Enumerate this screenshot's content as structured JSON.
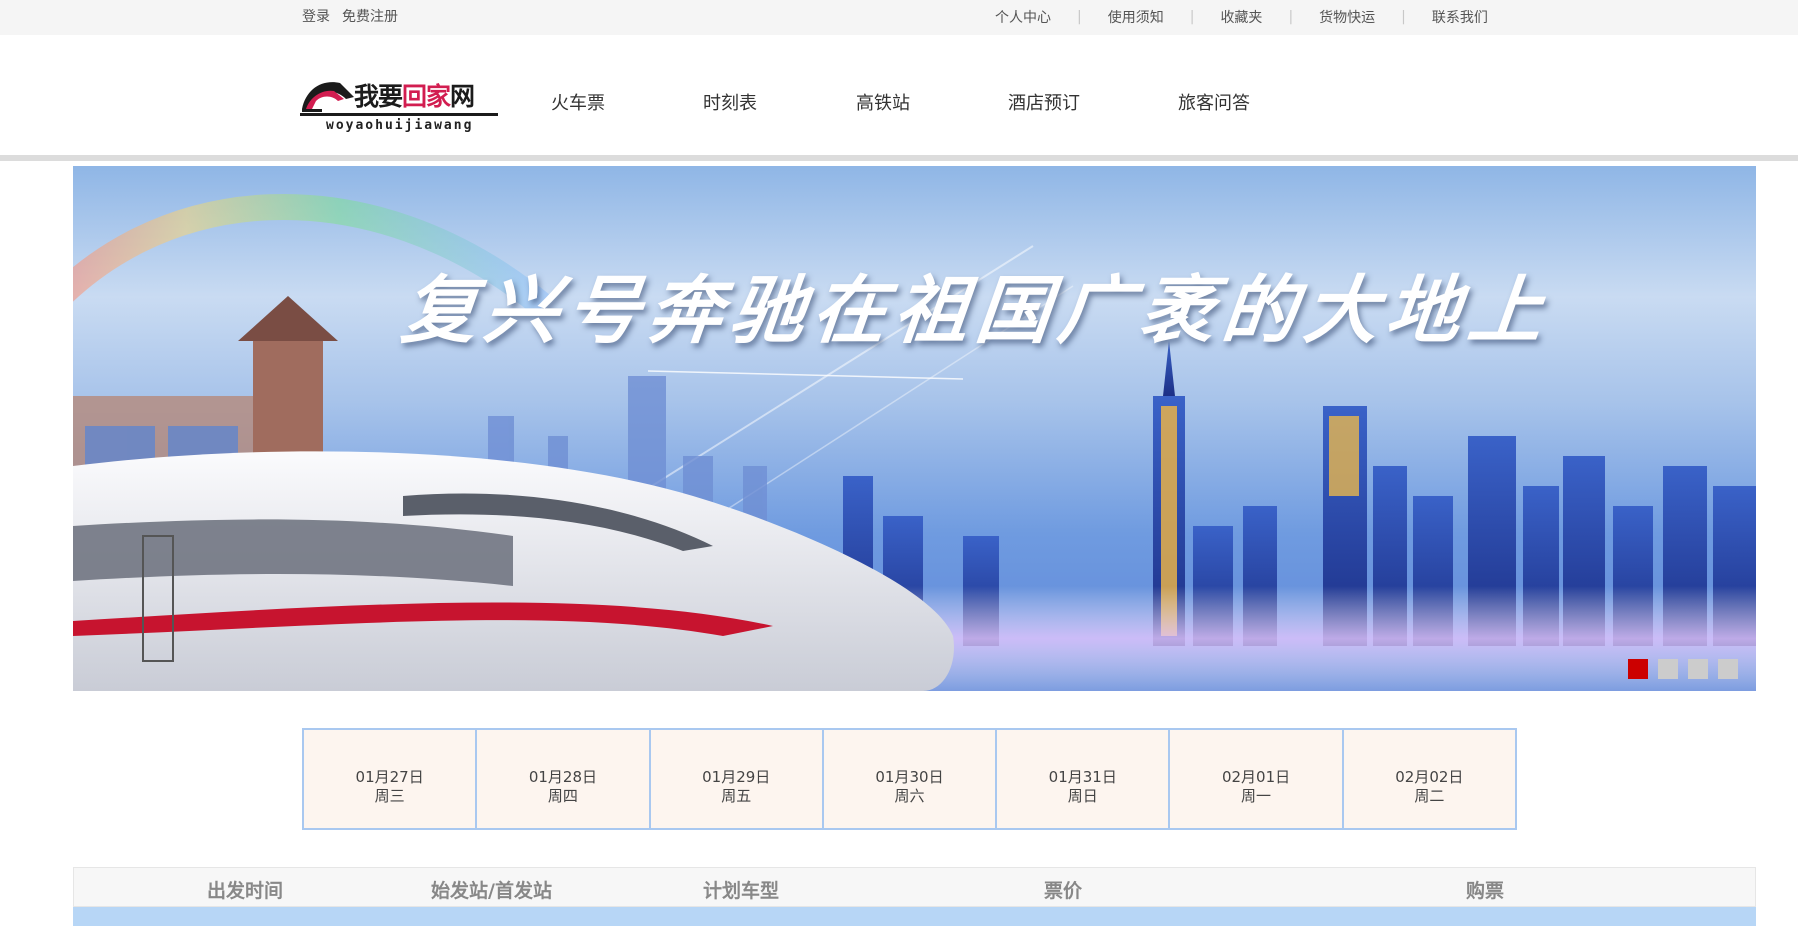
{
  "topbar": {
    "login": "登录",
    "register": "免费注册",
    "links": [
      "个人中心",
      "使用须知",
      "收藏夹",
      "货物快运",
      "联系我们"
    ],
    "separator": "|"
  },
  "logo": {
    "cn_a": "我要",
    "cn_b": "回家",
    "cn_c": "网",
    "pinyin": "woyaohuijiawang"
  },
  "nav": {
    "items": [
      "火车票",
      "时刻表",
      "高铁站",
      "酒店预订",
      "旅客问答"
    ]
  },
  "banner": {
    "slogan": "复兴号奔驰在祖国广袤的大地上",
    "slide_count": 4,
    "active_slide": 1,
    "accent_color": "#cc0000"
  },
  "dates": [
    {
      "date": "01月27日",
      "weekday": "周三"
    },
    {
      "date": "01月28日",
      "weekday": "周四"
    },
    {
      "date": "01月29日",
      "weekday": "周五"
    },
    {
      "date": "01月30日",
      "weekday": "周六"
    },
    {
      "date": "01月31日",
      "weekday": "周日"
    },
    {
      "date": "02月01日",
      "weekday": "周一"
    },
    {
      "date": "02月02日",
      "weekday": "周二"
    }
  ],
  "table": {
    "headers": [
      "出发时间",
      "始发站/首发站",
      "计划车型",
      "票价",
      "购票"
    ]
  }
}
